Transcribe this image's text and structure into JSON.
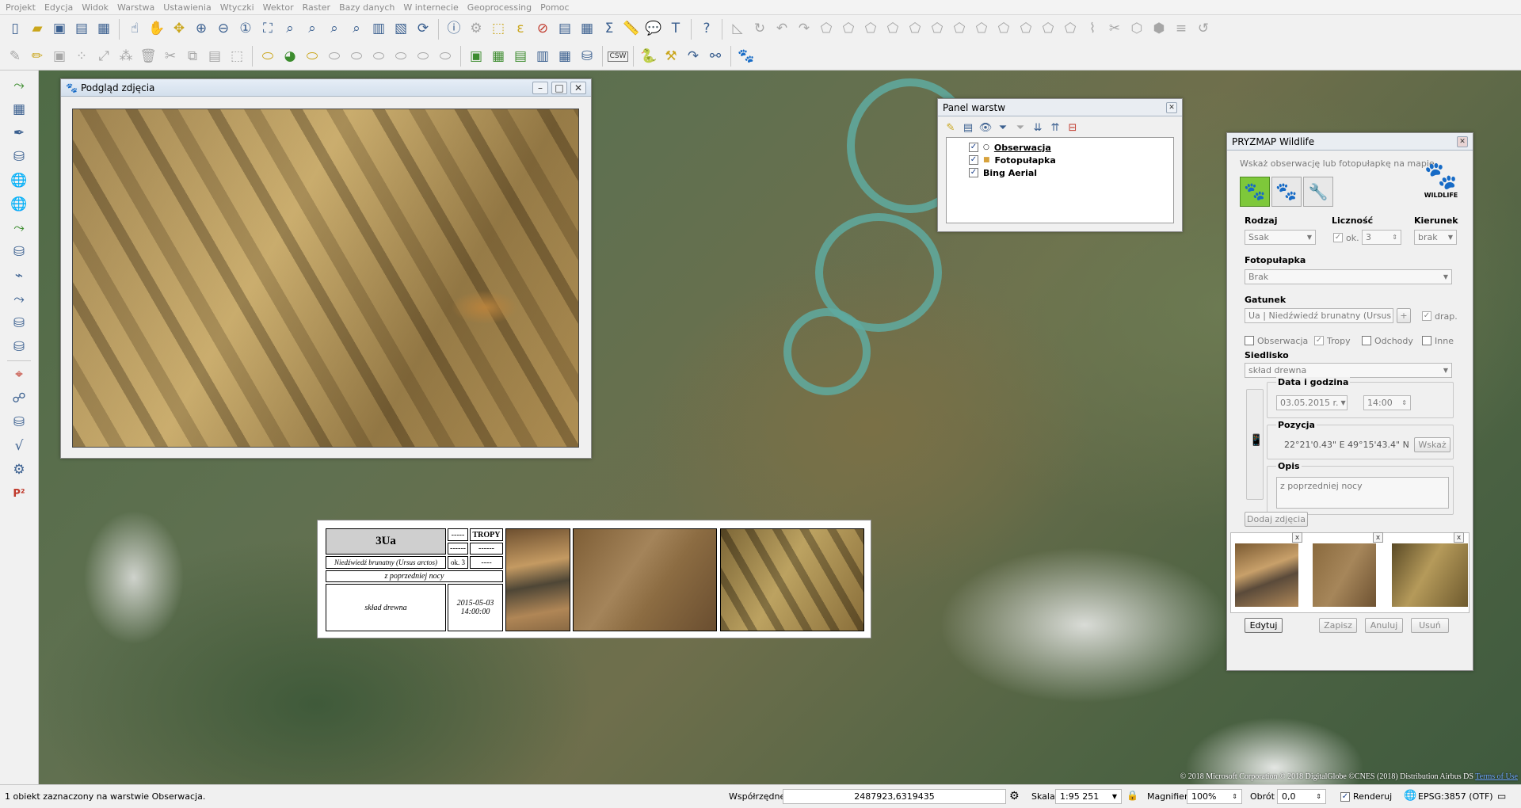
{
  "menu": [
    "Projekt",
    "Edycja",
    "Widok",
    "Warstwa",
    "Ustawienia",
    "Wtyczki",
    "Wektor",
    "Raster",
    "Bazy danych",
    "W internecie",
    "Geoprocessing",
    "Pomoc"
  ],
  "toolbar": {
    "csw_label": "CSW"
  },
  "photo_window": {
    "title": "Podgląd zdjęcia"
  },
  "layers_panel": {
    "title": "Panel warstw",
    "layers": [
      {
        "name": "Obserwacja",
        "checked": true
      },
      {
        "name": "Fotopułapka",
        "checked": true
      },
      {
        "name": "Bing Aerial",
        "checked": true
      }
    ]
  },
  "wildlife": {
    "title": "PRYZMAP Wildlife",
    "hint": "Wskaż obserwację lub fotopułapkę na mapie",
    "logo_text": "WILDLIFE",
    "rodzaj": {
      "label": "Rodzaj",
      "value": "Ssak"
    },
    "licznosc": {
      "label": "Liczność",
      "ok_label": "ok.",
      "value": "3"
    },
    "kierunek": {
      "label": "Kierunek",
      "value": "brak"
    },
    "fotopulapka": {
      "label": "Fotopułapka",
      "value": "Brak"
    },
    "gatunek": {
      "label": "Gatunek",
      "value": "Ua | Niedźwiedź brunatny (Ursus ar",
      "plus": "+",
      "drap": "drap."
    },
    "types": [
      {
        "label": "Obserwacja",
        "checked": false
      },
      {
        "label": "Tropy",
        "checked": true
      },
      {
        "label": "Odchody",
        "checked": false
      },
      {
        "label": "Inne",
        "checked": false
      }
    ],
    "siedlisko": {
      "label": "Siedlisko",
      "value": "skład drewna"
    },
    "data": {
      "label": "Data i godzina",
      "date": "03.05.2015 r.",
      "time": "14:00"
    },
    "pozycja": {
      "label": "Pozycja",
      "value": "22°21'0.43\" E  49°15'43.4\" N",
      "button": "Wskaż"
    },
    "opis": {
      "label": "Opis",
      "value": "z poprzedniej nocy"
    },
    "add_photos": "Dodaj zdjęcia",
    "buttons": {
      "edit": "Edytuj",
      "save": "Zapisz",
      "cancel": "Anuluj",
      "delete": "Usuń"
    }
  },
  "map_label": {
    "code": "3Ua",
    "c1": "-----",
    "c2": "TROPY",
    "c3": "------",
    "c4": "------",
    "species": "Niedźwiedź brunatny (Ursus arctos)",
    "count": "ok. 3",
    "dash": "----",
    "desc": "z poprzedniej nocy",
    "habitat": "skład drewna",
    "datetime": "2015-05-03 14:00:00"
  },
  "attribution": {
    "text": "© 2018 Microsoft Corporation © 2018 DigitalGlobe ©CNES (2018) Distribution Airbus DS ",
    "link": "Terms of Use"
  },
  "status": {
    "message": "1 obiekt zaznaczony na warstwie Obserwacja.",
    "coords_label": "Współrzędne",
    "coords": "2487923,6319435",
    "scale_label": "Skala",
    "scale": "1:95 251",
    "magnifier_label": "Magnifier",
    "magnifier": "100%",
    "rotation_label": "Obrót",
    "rotation": "0,0",
    "render_label": "Renderuj",
    "crs": "EPSG:3857 (OTF)"
  }
}
